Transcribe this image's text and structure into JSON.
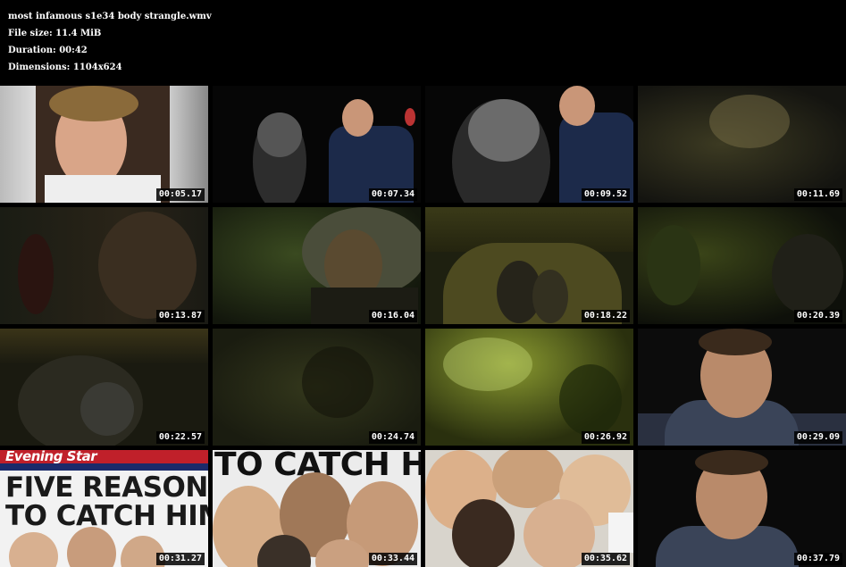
{
  "header": {
    "filename": "most infamous s1e34 body strangle.wmv",
    "file_size_label": "File size: 11.4 MiB",
    "duration_label": "Duration: 00:42",
    "dimensions_label": "Dimensions: 1104x624"
  },
  "thumbnails": [
    {
      "time": "00:05.17"
    },
    {
      "time": "00:07.34"
    },
    {
      "time": "00:09.52"
    },
    {
      "time": "00:11.69"
    },
    {
      "time": "00:13.87"
    },
    {
      "time": "00:16.04"
    },
    {
      "time": "00:18.22"
    },
    {
      "time": "00:20.39"
    },
    {
      "time": "00:22.57"
    },
    {
      "time": "00:24.74"
    },
    {
      "time": "00:26.92"
    },
    {
      "time": "00:29.09"
    },
    {
      "time": "00:31.27"
    },
    {
      "time": "00:33.44"
    },
    {
      "time": "00:35.62"
    },
    {
      "time": "00:37.79"
    }
  ],
  "newspaper": {
    "masthead": "Evening Star",
    "headline_line1": "FIVE REASONS",
    "headline_line2": "TO CATCH HIM",
    "crop_headline": "TO CATCH HIM"
  }
}
